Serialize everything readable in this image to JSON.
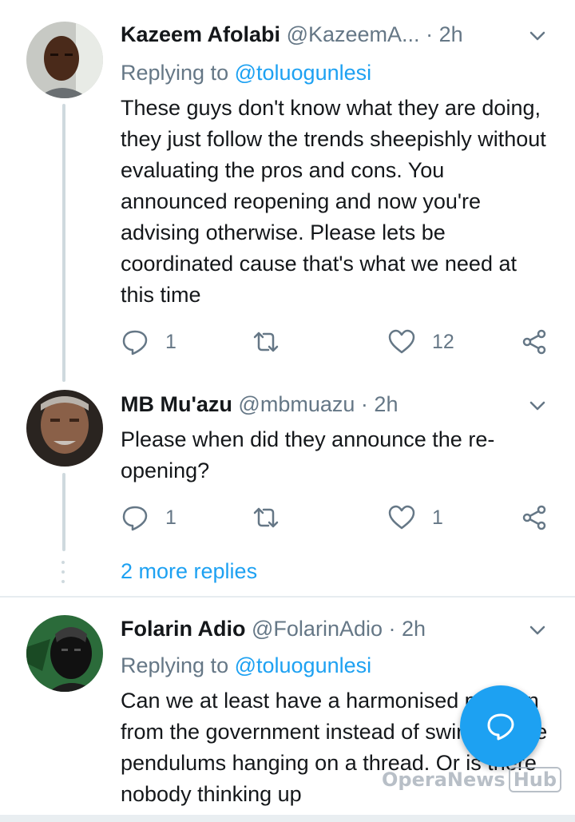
{
  "tweets": [
    {
      "name": "Kazeem Afolabi",
      "handle": "@KazeemA...",
      "separator": "·",
      "time": "2h",
      "replying_prefix": "Replying to ",
      "replying_to": "@toluogunlesi",
      "text": "These guys don't know what they are doing, they just follow the trends sheepishly without evaluating the pros and cons. You announced reopening and now you're advising otherwise. Please lets be coordinated cause that's what we need at this time",
      "reply_count": "1",
      "retweet_count": "",
      "like_count": "12"
    },
    {
      "name": "MB Mu'azu",
      "handle": "@mbmuazu",
      "separator": "·",
      "time": "2h",
      "text": "Please when did they announce the re-opening?",
      "reply_count": "1",
      "retweet_count": "",
      "like_count": "1"
    },
    {
      "name": "Folarin Adio",
      "handle": "@FolarinAdio",
      "separator": "·",
      "time": "2h",
      "replying_prefix": "Replying to ",
      "replying_to": "@toluogunlesi",
      "text": "Can we at least have a harmonised position from the government instead of swinging like pendulums hanging on a thread. Or is there nobody thinking up"
    }
  ],
  "more_replies": "2 more replies",
  "watermark": {
    "brand": "OperaNews",
    "suffix": "Hub"
  },
  "colors": {
    "accent": "#1da1f2",
    "muted": "#657786",
    "text": "#14171a"
  },
  "icons": [
    "reply-icon",
    "retweet-icon",
    "like-icon",
    "share-icon",
    "caret-down-icon",
    "compose-reply-icon"
  ]
}
